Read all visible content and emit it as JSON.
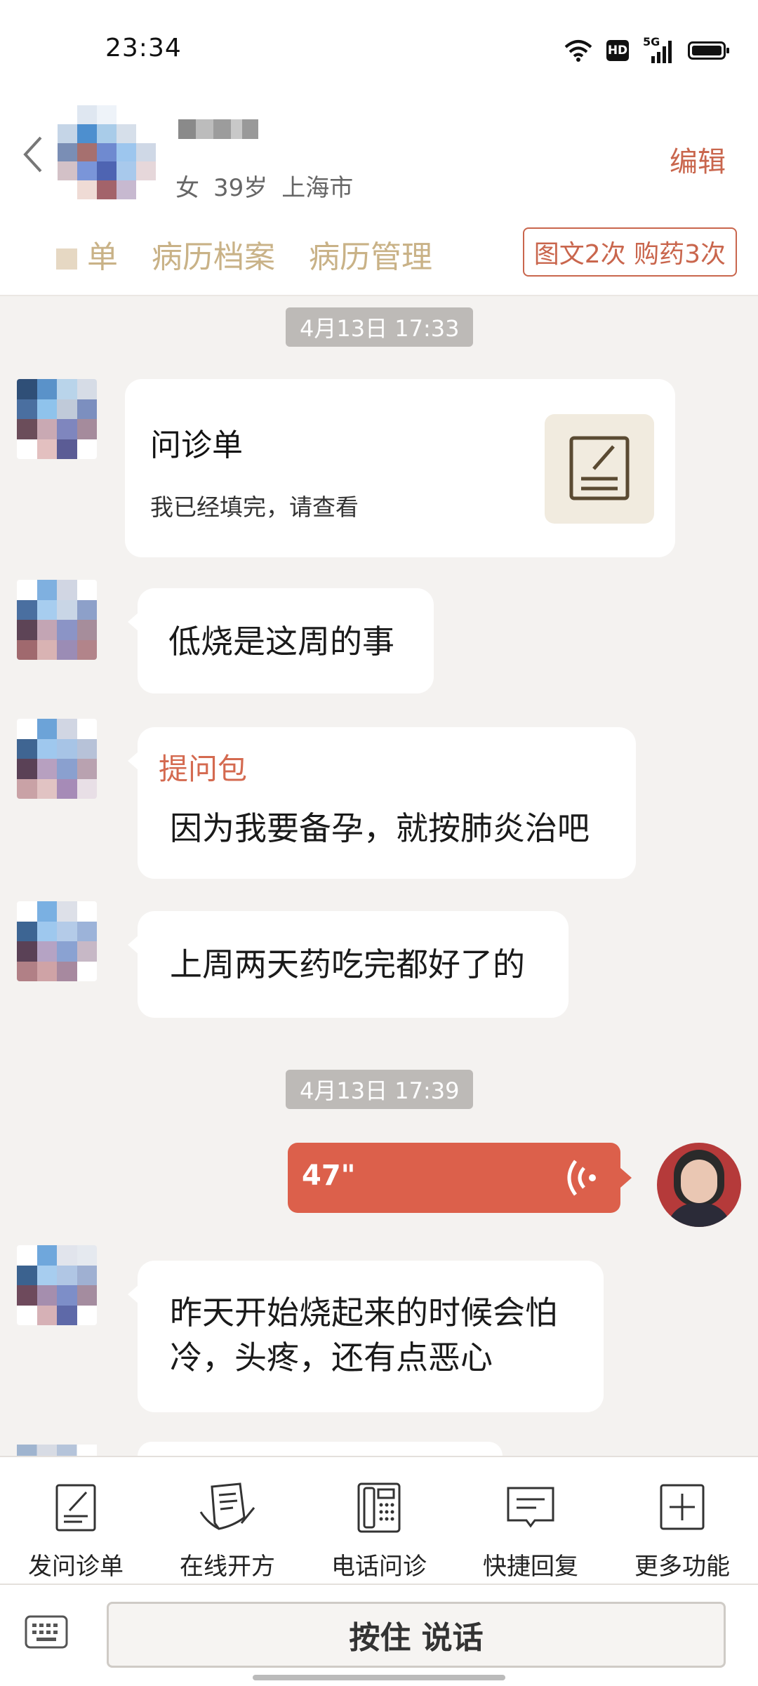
{
  "status_bar": {
    "time": "23:34",
    "hd": "HD",
    "net": "5G"
  },
  "patient": {
    "gender": "女",
    "age": "39岁",
    "city": "上海市"
  },
  "header": {
    "edit_label": "编辑",
    "tabs": [
      "单",
      "病历档案",
      "病历管理"
    ],
    "counter": "图文2次 购药3次"
  },
  "chat": {
    "timestamps": [
      "4月13日 17:33",
      "4月13日 17:39"
    ],
    "form_card": {
      "title": "问诊单",
      "subtitle": "我已经填完，请查看"
    },
    "messages": [
      {
        "text": "低烧是这周的事"
      },
      {
        "tag": "提问包",
        "text": "因为我要备孕，就按肺炎治吧"
      },
      {
        "text": "上周两天药吃完都好了的"
      },
      {
        "text_line1": "昨天开始烧起来的时候会怕",
        "text_line2": "冷，头疼，还有点恶心"
      }
    ],
    "voice": {
      "duration": "47\""
    }
  },
  "toolbar": {
    "items": [
      {
        "label": "发问诊单",
        "icon": "form-icon"
      },
      {
        "label": "在线开方",
        "icon": "prescription-icon"
      },
      {
        "label": "电话问诊",
        "icon": "phone-icon"
      },
      {
        "label": "快捷回复",
        "icon": "quick-reply-icon"
      },
      {
        "label": "更多功能",
        "icon": "plus-box-icon"
      }
    ]
  },
  "input": {
    "talk_label": "按住 说话"
  },
  "colors": {
    "accent": "#c9664d",
    "voice_bubble": "#dc604b",
    "tab_text": "#c9b287",
    "timestamp_bg": "#bdbab7"
  }
}
